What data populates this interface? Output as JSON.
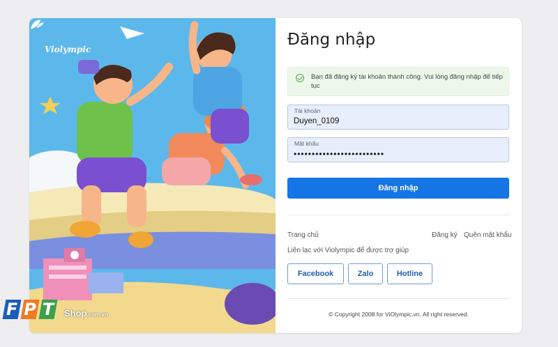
{
  "brand": {
    "logo_text": "Violympic"
  },
  "login": {
    "title": "Đăng nhập",
    "success_message": "Bạn đã đăng ký tài khoản thành công. Vui lòng đăng nhập để tiếp tục",
    "username": {
      "label": "Tài khoản",
      "value": "Duyen_0109"
    },
    "password": {
      "label": "Mật khẩu",
      "value": "•••••••••••••••••••••••••"
    },
    "submit_label": "Đăng nhập"
  },
  "links": {
    "home": "Trang chủ",
    "register": "Đăng ký",
    "forgot": "Quên mật khẩu",
    "help_text": "Liên lạc với Violympic để được trợ giúp"
  },
  "contact_buttons": [
    "Facebook",
    "Zalo",
    "Hotline"
  ],
  "footer": {
    "copyright": "© Copyright 2008 for ViOlympic.vn. All right reserved."
  },
  "watermark": {
    "letters": [
      "F",
      "P",
      "T"
    ],
    "shop": "Shop",
    "domain": ".com.vn"
  },
  "colors": {
    "primary": "#1675e4",
    "illustration_bg": "#5cb8ea",
    "success_bg": "#edf7ea",
    "input_bg": "#e8effc"
  }
}
